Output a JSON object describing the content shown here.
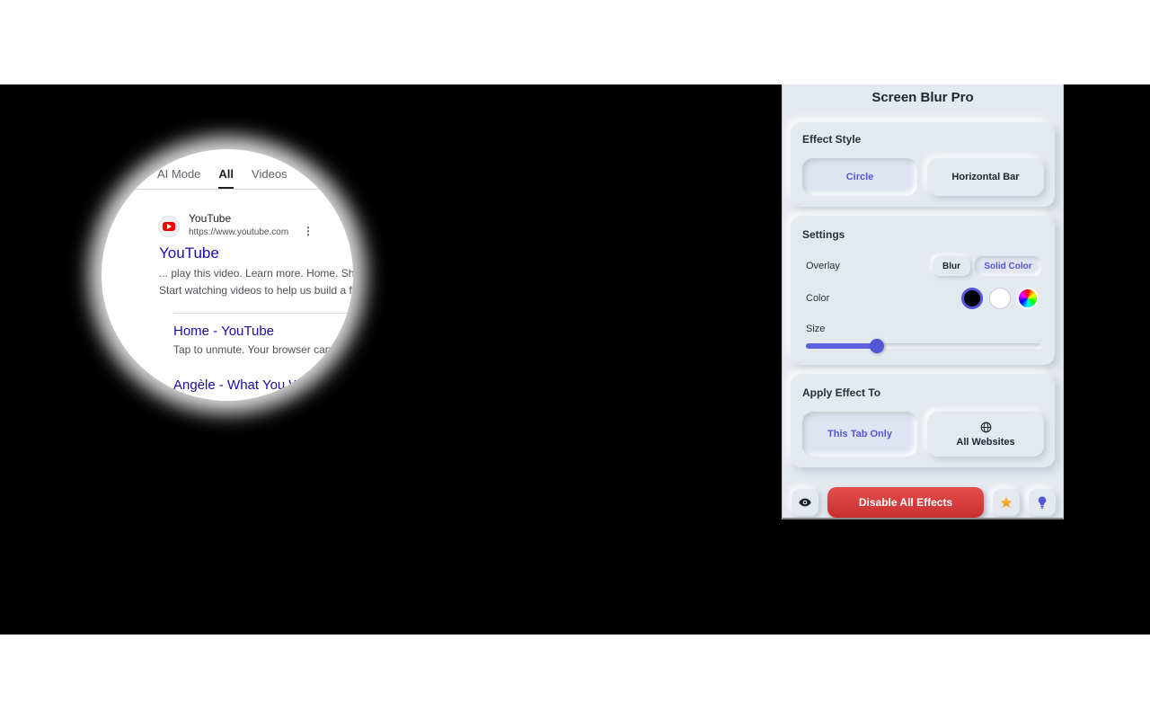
{
  "search": {
    "tabs": [
      {
        "label": "AI Mode"
      },
      {
        "label": "All"
      },
      {
        "label": "Videos"
      }
    ],
    "result": {
      "site_name": "YouTube",
      "url": "https://www.youtube.com",
      "title": "YouTube",
      "snippet_line1": "... play this video. Learn more. Home. Sh",
      "snippet_line2": "Start watching videos to help us build a f"
    },
    "sublinks": [
      {
        "title": "Home - YouTube",
        "desc": "Tap to unmute. Your browser can"
      },
      {
        "title": "Angèle - What You W"
      }
    ]
  },
  "popup": {
    "title": "Screen Blur Pro",
    "effect_style": {
      "heading": "Effect Style",
      "options": [
        "Circle",
        "Horizontal Bar"
      ],
      "selected": "Circle"
    },
    "settings": {
      "heading": "Settings",
      "overlay_label": "Overlay",
      "overlay_options": [
        "Blur",
        "Solid Color"
      ],
      "overlay_selected": "Solid Color",
      "color_label": "Color",
      "colors": [
        "#000000",
        "#ffffff",
        "rainbow"
      ],
      "selected_color": "#000000",
      "size_label": "Size",
      "size_value": 0.3
    },
    "apply_to": {
      "heading": "Apply Effect To",
      "options": [
        "This Tab Only",
        "All Websites"
      ],
      "selected": "This Tab Only"
    },
    "footer": {
      "disable_label": "Disable All Effects"
    },
    "accent_color": "#5356d6",
    "danger_color": "#d63c3c"
  }
}
